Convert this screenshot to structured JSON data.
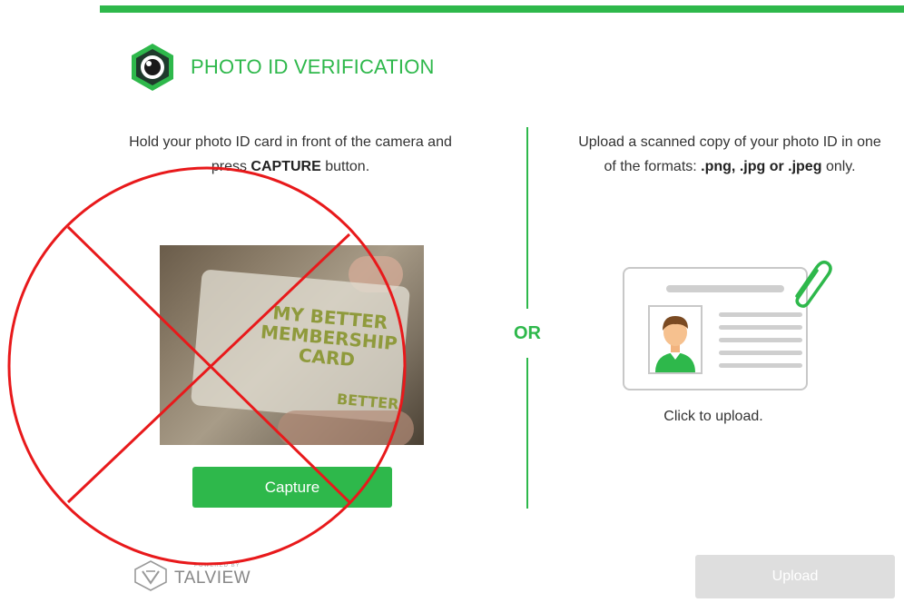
{
  "header": {
    "title": "PHOTO ID VERIFICATION",
    "accent_color": "#2eb84b"
  },
  "camera_option": {
    "instruction_part1": "Hold your photo ID card in front of the camera and press",
    "instruction_bold": "CAPTURE",
    "instruction_part2": "button.",
    "preview_card_text": "MY BETTER MEMBERSHIP CARD",
    "preview_card_brand": "BETTER",
    "capture_label": "Capture"
  },
  "separator": {
    "label": "OR"
  },
  "upload_option": {
    "instruction_part1": "Upload a scanned copy of your photo ID in one of the formats:",
    "instruction_bold": ".png, .jpg or .jpeg",
    "instruction_part2": "only.",
    "click_label": "Click to upload.",
    "upload_label": "Upload",
    "upload_disabled": true
  },
  "footer": {
    "powered_by": "POWERED BY",
    "brand_name": "TALVIEW"
  },
  "annotation": {
    "mark": "red-cross-circle-icon",
    "color": "#e8191b"
  },
  "icons": [
    "camera-lens-icon",
    "paperclip-icon",
    "id-card-icon",
    "person-avatar-icon",
    "talview-logo-icon"
  ]
}
